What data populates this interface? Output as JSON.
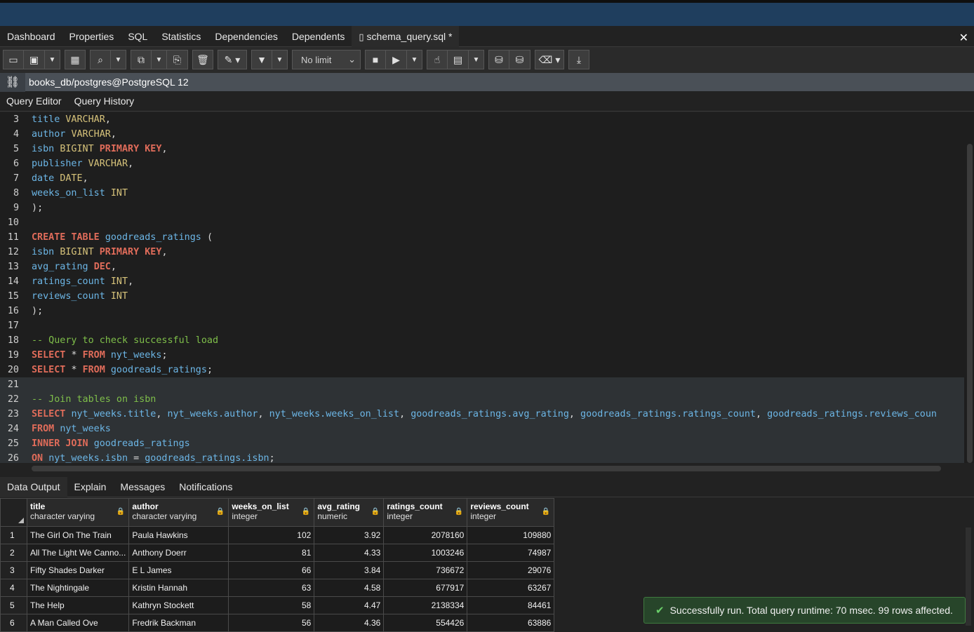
{
  "tabs": [
    {
      "label": "Dashboard"
    },
    {
      "label": "Properties"
    },
    {
      "label": "SQL"
    },
    {
      "label": "Statistics"
    },
    {
      "label": "Dependencies"
    },
    {
      "label": "Dependents"
    },
    {
      "label": "schema_query.sql *"
    }
  ],
  "toolbar": {
    "limit_select": "No limit"
  },
  "connection": {
    "label": "books_db/postgres@PostgreSQL 12"
  },
  "subtabs": [
    {
      "label": "Query Editor"
    },
    {
      "label": "Query History"
    }
  ],
  "editor": {
    "lines": [
      {
        "n": "3",
        "text": "title VARCHAR,"
      },
      {
        "n": "4",
        "text": "author VARCHAR,"
      },
      {
        "n": "5",
        "text": "isbn BIGINT PRIMARY KEY,"
      },
      {
        "n": "6",
        "text": "publisher VARCHAR,"
      },
      {
        "n": "7",
        "text": "date DATE,"
      },
      {
        "n": "8",
        "text": "weeks_on_list INT"
      },
      {
        "n": "9",
        "text": ");"
      },
      {
        "n": "10",
        "text": ""
      },
      {
        "n": "11",
        "text": "CREATE TABLE goodreads_ratings ("
      },
      {
        "n": "12",
        "text": "isbn BIGINT PRIMARY KEY,"
      },
      {
        "n": "13",
        "text": "avg_rating DEC,"
      },
      {
        "n": "14",
        "text": "ratings_count INT,"
      },
      {
        "n": "15",
        "text": "reviews_count INT"
      },
      {
        "n": "16",
        "text": ");"
      },
      {
        "n": "17",
        "text": ""
      },
      {
        "n": "18",
        "text": "-- Query to check successful load"
      },
      {
        "n": "19",
        "text": "SELECT * FROM nyt_weeks;"
      },
      {
        "n": "20",
        "text": "SELECT * FROM goodreads_ratings;"
      },
      {
        "n": "21",
        "text": ""
      },
      {
        "n": "22",
        "text": "-- Join tables on isbn"
      },
      {
        "n": "23",
        "text": "SELECT nyt_weeks.title, nyt_weeks.author, nyt_weeks.weeks_on_list, goodreads_ratings.avg_rating, goodreads_ratings.ratings_count, goodreads_ratings.reviews_coun"
      },
      {
        "n": "24",
        "text": "FROM nyt_weeks"
      },
      {
        "n": "25",
        "text": "INNER JOIN goodreads_ratings"
      },
      {
        "n": "26",
        "text": "ON nyt_weeks.isbn = goodreads_ratings.isbn;"
      }
    ]
  },
  "output_tabs": [
    {
      "label": "Data Output"
    },
    {
      "label": "Explain"
    },
    {
      "label": "Messages"
    },
    {
      "label": "Notifications"
    }
  ],
  "grid": {
    "columns": [
      {
        "name": "title",
        "type": "character varying"
      },
      {
        "name": "author",
        "type": "character varying"
      },
      {
        "name": "weeks_on_list",
        "type": "integer"
      },
      {
        "name": "avg_rating",
        "type": "numeric"
      },
      {
        "name": "ratings_count",
        "type": "integer"
      },
      {
        "name": "reviews_count",
        "type": "integer"
      }
    ],
    "rows": [
      [
        "1",
        "The Girl On The Train",
        "Paula Hawkins",
        "102",
        "3.92",
        "2078160",
        "109880"
      ],
      [
        "2",
        "All The Light We Canno...",
        "Anthony Doerr",
        "81",
        "4.33",
        "1003246",
        "74987"
      ],
      [
        "3",
        "Fifty Shades Darker",
        "E L James",
        "66",
        "3.84",
        "736672",
        "29076"
      ],
      [
        "4",
        "The Nightingale",
        "Kristin Hannah",
        "63",
        "4.58",
        "677917",
        "63267"
      ],
      [
        "5",
        "The Help",
        "Kathryn Stockett",
        "58",
        "4.47",
        "2138334",
        "84461"
      ],
      [
        "6",
        "A Man Called Ove",
        "Fredrik Backman",
        "56",
        "4.36",
        "554426",
        "63886"
      ]
    ]
  },
  "toast": {
    "message": "Successfully run. Total query runtime: 70 msec. 99 rows affected."
  }
}
